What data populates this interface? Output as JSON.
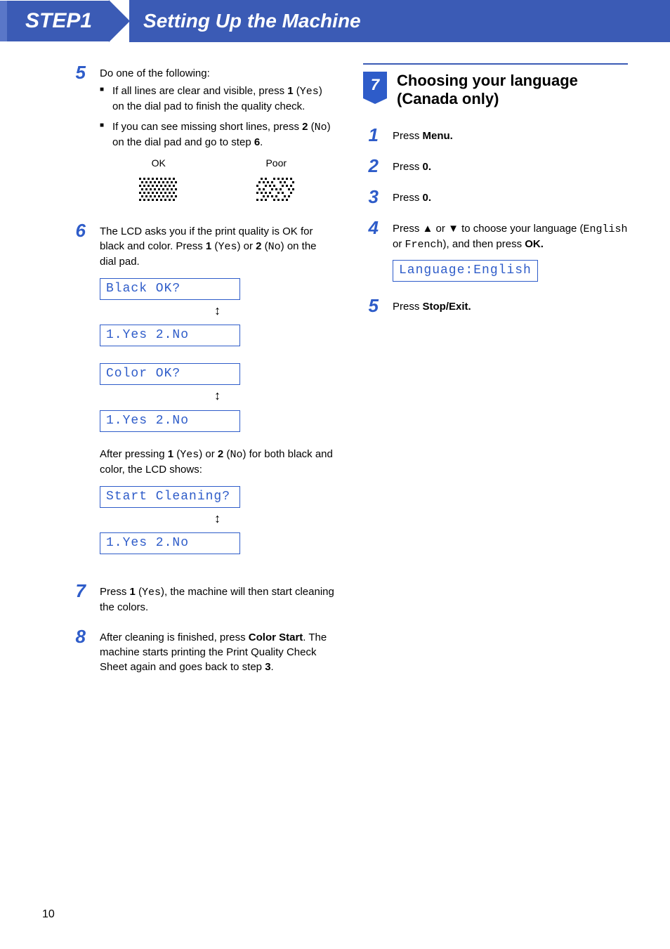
{
  "header": {
    "step_tab": "STEP1",
    "title": "Setting Up the Machine"
  },
  "left": {
    "step5": {
      "num": "5",
      "intro": "Do one of the following:",
      "bullet1_a": "If all lines are clear and visible, press ",
      "bullet1_b": "1",
      "bullet1_c": " (",
      "bullet1_d": "Yes",
      "bullet1_e": ") on the dial pad to finish the quality check.",
      "bullet2_a": "If you can see missing short lines, press ",
      "bullet2_b": "2",
      "bullet2_c": " (",
      "bullet2_d": "No",
      "bullet2_e": ") on the dial pad and go to step ",
      "bullet2_f": "6",
      "bullet2_g": ".",
      "ok_label": "OK",
      "poor_label": "Poor"
    },
    "step6": {
      "num": "6",
      "text_a": "The LCD asks you if the print quality is OK for black and color. Press ",
      "text_b": "1",
      "text_c": " (",
      "text_d": "Yes",
      "text_e": ") or ",
      "text_f": "2",
      "text_g": " (",
      "text_h": "No",
      "text_i": ") on the dial pad.",
      "lcd1": "Black OK?",
      "lcd_yn": "1.Yes 2.No",
      "lcd2": "Color OK?",
      "after_a": "After pressing ",
      "after_b": "1",
      "after_c": " (",
      "after_d": "Yes",
      "after_e": ") or ",
      "after_f": "2",
      "after_g": " (",
      "after_h": "No",
      "after_i": ") for both black and color, the LCD shows:",
      "lcd3": "Start Cleaning?",
      "updown": "↕"
    },
    "step7": {
      "num": "7",
      "text_a": "Press ",
      "text_b": "1",
      "text_c": " (",
      "text_d": "Yes",
      "text_e": "), the machine will then start cleaning the colors."
    },
    "step8": {
      "num": "8",
      "text_a": "After cleaning is finished, press ",
      "text_b": "Color Start",
      "text_c": ". The machine starts printing the Print Quality Check Sheet again and goes back to step ",
      "text_d": "3",
      "text_e": "."
    }
  },
  "right": {
    "section": {
      "num": "7",
      "title": "Choosing your language (Canada only)"
    },
    "r1": {
      "num": "1",
      "a": "Press ",
      "b": "Menu."
    },
    "r2": {
      "num": "2",
      "a": "Press ",
      "b": "0."
    },
    "r3": {
      "num": "3",
      "a": "Press ",
      "b": "0."
    },
    "r4": {
      "num": "4",
      "a": "Press ",
      "up": "▲",
      "b": " or ",
      "down": "▼",
      "c": " to choose your language (",
      "eng": "English",
      "d": " or ",
      "fr": "French",
      "e": "), and then press ",
      "ok": "OK.",
      "lcd": "Language:English"
    },
    "r5": {
      "num": "5",
      "a": "Press ",
      "b": "Stop/Exit."
    }
  },
  "page_number": "10"
}
